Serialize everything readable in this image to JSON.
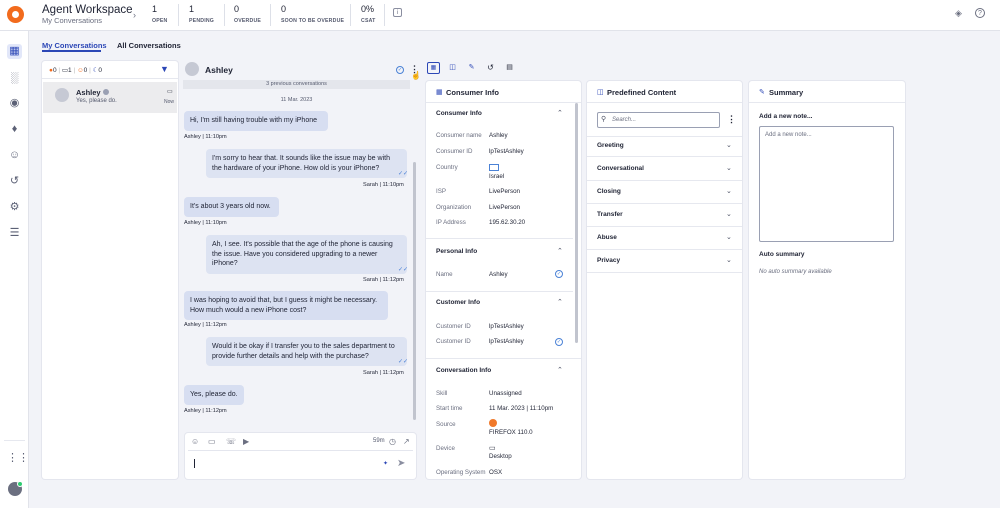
{
  "header": {
    "title": "Agent Workspace",
    "subtitle": "My Conversations",
    "stats": [
      {
        "value": "1",
        "label": "OPEN"
      },
      {
        "value": "1",
        "label": "PENDING"
      },
      {
        "value": "0",
        "label": "OVERDUE"
      },
      {
        "value": "0",
        "label": "SOON TO BE OVERDUE"
      },
      {
        "value": "0%",
        "label": "CSAT"
      }
    ]
  },
  "tabs": {
    "my": "My Conversations",
    "all": "All Conversations"
  },
  "list": {
    "filters": [
      "0",
      "1",
      "0",
      "0"
    ],
    "item": {
      "name": "Ashley",
      "preview": "Yes, please do.",
      "time": "Now"
    }
  },
  "chat": {
    "name": "Ashley",
    "previous": "3 previous conversations",
    "date": "11 Mar. 2023",
    "messages": [
      {
        "side": "consumer",
        "text": "Hi, I'm still having trouble with my iPhone",
        "meta": "Ashley  |  11:10pm"
      },
      {
        "side": "agent",
        "text": "I'm sorry to hear that. It sounds like the issue may be with the hardware of your iPhone. How old is your iPhone?",
        "meta": "Sarah  |  11:10pm"
      },
      {
        "side": "consumer",
        "text": "It's about 3 years old now.",
        "meta": "Ashley  |  11:10pm"
      },
      {
        "side": "agent",
        "text": "Ah, I see. It's possible that the age of the phone is causing the issue. Have you considered upgrading to a newer iPhone?",
        "meta": "Sarah  |  11:12pm"
      },
      {
        "side": "consumer",
        "text": "I was hoping to avoid that, but I guess it might be necessary. How much would a new iPhone cost?",
        "meta": "Ashley  |  11:12pm"
      },
      {
        "side": "agent",
        "text": "Would it be okay if I transfer you to the sales department to provide further details and help with the purchase?",
        "meta": "Sarah  |  11:12pm"
      },
      {
        "side": "consumer",
        "text": "Yes, please do.",
        "meta": "Ashley  |  11:12pm"
      }
    ],
    "composer_timer": "59m"
  },
  "consumer_info": {
    "title": "Consumer Info",
    "section_title": "Consumer Info",
    "rows": [
      {
        "label": "Consumer name",
        "value": "Ashley"
      },
      {
        "label": "Consumer ID",
        "value": "lpTestAshley"
      },
      {
        "label": "Country",
        "value": "Israel"
      },
      {
        "label": "ISP",
        "value": "LivePerson"
      },
      {
        "label": "Organization",
        "value": "LivePerson"
      },
      {
        "label": "IP Address",
        "value": "195.62.30.20"
      }
    ],
    "personal": {
      "title": "Personal Info",
      "label": "Name",
      "value": "Ashley"
    },
    "customer": {
      "title": "Customer Info",
      "rows": [
        {
          "label": "Customer ID",
          "value": "lpTestAshley"
        },
        {
          "label": "Customer ID",
          "value": "lpTestAshley"
        }
      ]
    },
    "conversation": {
      "title": "Conversation Info",
      "rows": [
        {
          "label": "Skill",
          "value": "Unassigned"
        },
        {
          "label": "Start time",
          "value": "11 Mar. 2023 | 11:10pm"
        },
        {
          "label": "Source",
          "value": "FIREFOX 110.0"
        },
        {
          "label": "Device",
          "value": "Desktop"
        },
        {
          "label": "Operating System",
          "value": "OSX"
        }
      ]
    }
  },
  "predefined": {
    "title": "Predefined Content",
    "search_placeholder": "Search...",
    "categories": [
      "Greeting",
      "Conversational",
      "Closing",
      "Transfer",
      "Abuse",
      "Privacy"
    ]
  },
  "summary": {
    "title": "Summary",
    "add_note_label": "Add a new note...",
    "note_placeholder": "Add a new note...",
    "auto_title": "Auto summary",
    "auto_empty": "No auto summary available"
  }
}
